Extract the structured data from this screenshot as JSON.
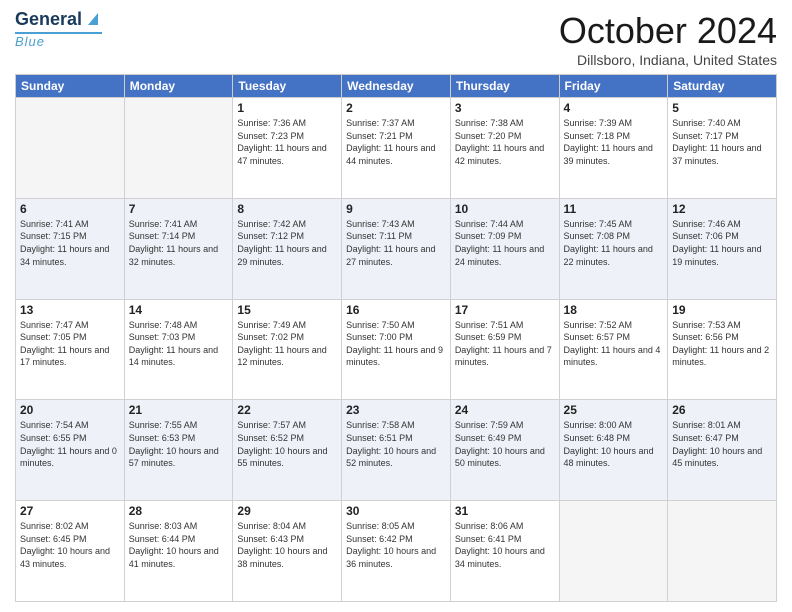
{
  "header": {
    "logo_line1": "General",
    "logo_line2": "Blue",
    "title": "October 2024",
    "subtitle": "Dillsboro, Indiana, United States"
  },
  "days_of_week": [
    "Sunday",
    "Monday",
    "Tuesday",
    "Wednesday",
    "Thursday",
    "Friday",
    "Saturday"
  ],
  "weeks": [
    [
      {
        "day": "",
        "info": ""
      },
      {
        "day": "",
        "info": ""
      },
      {
        "day": "1",
        "info": "Sunrise: 7:36 AM\nSunset: 7:23 PM\nDaylight: 11 hours and 47 minutes."
      },
      {
        "day": "2",
        "info": "Sunrise: 7:37 AM\nSunset: 7:21 PM\nDaylight: 11 hours and 44 minutes."
      },
      {
        "day": "3",
        "info": "Sunrise: 7:38 AM\nSunset: 7:20 PM\nDaylight: 11 hours and 42 minutes."
      },
      {
        "day": "4",
        "info": "Sunrise: 7:39 AM\nSunset: 7:18 PM\nDaylight: 11 hours and 39 minutes."
      },
      {
        "day": "5",
        "info": "Sunrise: 7:40 AM\nSunset: 7:17 PM\nDaylight: 11 hours and 37 minutes."
      }
    ],
    [
      {
        "day": "6",
        "info": "Sunrise: 7:41 AM\nSunset: 7:15 PM\nDaylight: 11 hours and 34 minutes."
      },
      {
        "day": "7",
        "info": "Sunrise: 7:41 AM\nSunset: 7:14 PM\nDaylight: 11 hours and 32 minutes."
      },
      {
        "day": "8",
        "info": "Sunrise: 7:42 AM\nSunset: 7:12 PM\nDaylight: 11 hours and 29 minutes."
      },
      {
        "day": "9",
        "info": "Sunrise: 7:43 AM\nSunset: 7:11 PM\nDaylight: 11 hours and 27 minutes."
      },
      {
        "day": "10",
        "info": "Sunrise: 7:44 AM\nSunset: 7:09 PM\nDaylight: 11 hours and 24 minutes."
      },
      {
        "day": "11",
        "info": "Sunrise: 7:45 AM\nSunset: 7:08 PM\nDaylight: 11 hours and 22 minutes."
      },
      {
        "day": "12",
        "info": "Sunrise: 7:46 AM\nSunset: 7:06 PM\nDaylight: 11 hours and 19 minutes."
      }
    ],
    [
      {
        "day": "13",
        "info": "Sunrise: 7:47 AM\nSunset: 7:05 PM\nDaylight: 11 hours and 17 minutes."
      },
      {
        "day": "14",
        "info": "Sunrise: 7:48 AM\nSunset: 7:03 PM\nDaylight: 11 hours and 14 minutes."
      },
      {
        "day": "15",
        "info": "Sunrise: 7:49 AM\nSunset: 7:02 PM\nDaylight: 11 hours and 12 minutes."
      },
      {
        "day": "16",
        "info": "Sunrise: 7:50 AM\nSunset: 7:00 PM\nDaylight: 11 hours and 9 minutes."
      },
      {
        "day": "17",
        "info": "Sunrise: 7:51 AM\nSunset: 6:59 PM\nDaylight: 11 hours and 7 minutes."
      },
      {
        "day": "18",
        "info": "Sunrise: 7:52 AM\nSunset: 6:57 PM\nDaylight: 11 hours and 4 minutes."
      },
      {
        "day": "19",
        "info": "Sunrise: 7:53 AM\nSunset: 6:56 PM\nDaylight: 11 hours and 2 minutes."
      }
    ],
    [
      {
        "day": "20",
        "info": "Sunrise: 7:54 AM\nSunset: 6:55 PM\nDaylight: 11 hours and 0 minutes."
      },
      {
        "day": "21",
        "info": "Sunrise: 7:55 AM\nSunset: 6:53 PM\nDaylight: 10 hours and 57 minutes."
      },
      {
        "day": "22",
        "info": "Sunrise: 7:57 AM\nSunset: 6:52 PM\nDaylight: 10 hours and 55 minutes."
      },
      {
        "day": "23",
        "info": "Sunrise: 7:58 AM\nSunset: 6:51 PM\nDaylight: 10 hours and 52 minutes."
      },
      {
        "day": "24",
        "info": "Sunrise: 7:59 AM\nSunset: 6:49 PM\nDaylight: 10 hours and 50 minutes."
      },
      {
        "day": "25",
        "info": "Sunrise: 8:00 AM\nSunset: 6:48 PM\nDaylight: 10 hours and 48 minutes."
      },
      {
        "day": "26",
        "info": "Sunrise: 8:01 AM\nSunset: 6:47 PM\nDaylight: 10 hours and 45 minutes."
      }
    ],
    [
      {
        "day": "27",
        "info": "Sunrise: 8:02 AM\nSunset: 6:45 PM\nDaylight: 10 hours and 43 minutes."
      },
      {
        "day": "28",
        "info": "Sunrise: 8:03 AM\nSunset: 6:44 PM\nDaylight: 10 hours and 41 minutes."
      },
      {
        "day": "29",
        "info": "Sunrise: 8:04 AM\nSunset: 6:43 PM\nDaylight: 10 hours and 38 minutes."
      },
      {
        "day": "30",
        "info": "Sunrise: 8:05 AM\nSunset: 6:42 PM\nDaylight: 10 hours and 36 minutes."
      },
      {
        "day": "31",
        "info": "Sunrise: 8:06 AM\nSunset: 6:41 PM\nDaylight: 10 hours and 34 minutes."
      },
      {
        "day": "",
        "info": ""
      },
      {
        "day": "",
        "info": ""
      }
    ]
  ]
}
